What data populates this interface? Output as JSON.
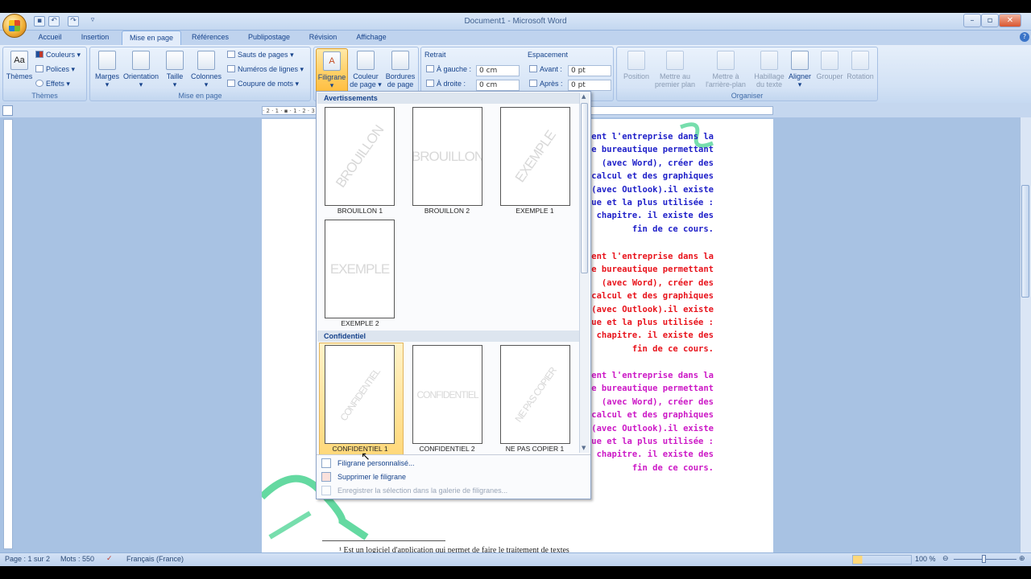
{
  "window": {
    "title": "Document1 - Microsoft Word"
  },
  "qat": {
    "save": "▪",
    "undo": "↶",
    "redo": "↷",
    "more": "▿"
  },
  "tabs": [
    "Accueil",
    "Insertion",
    "Mise en page",
    "Références",
    "Publipostage",
    "Révision",
    "Affichage"
  ],
  "ribbon": {
    "themes": {
      "label": "Thèmes",
      "group": "Thèmes",
      "couleurs": "Couleurs",
      "polices": "Polices",
      "effets": "Effets"
    },
    "mise_en_page": {
      "group": "Mise en page",
      "marges": "Marges",
      "orientation": "Orientation",
      "taille": "Taille",
      "colonnes": "Colonnes",
      "sauts": "Sauts de pages",
      "numeros": "Numéros de lignes",
      "coupure": "Coupure de mots"
    },
    "arriere_plan": {
      "filigrane": "Filigrane",
      "couleur1": "Couleur",
      "couleur2": "de page",
      "bordures1": "Bordures",
      "bordures2": "de page"
    },
    "paragraphe": {
      "retrait": "Retrait",
      "gauche_label": "À gauche :",
      "gauche_value": "0 cm",
      "droite_label": "À droite :",
      "droite_value": "0 cm",
      "espacement": "Espacement",
      "avant_label": "Avant :",
      "avant_value": "0 pt",
      "apres_label": "Après :",
      "apres_value": "0 pt"
    },
    "organiser": {
      "group": "Organiser",
      "position": "Position",
      "premier1": "Mettre au",
      "premier2": "premier plan",
      "arriere1": "Mettre à",
      "arriere2": "l'arrière-plan",
      "habillage1": "Habillage",
      "habillage2": "du texte",
      "aligner": "Aligner",
      "grouper": "Grouper",
      "rotation": "Rotation"
    }
  },
  "ruler": {
    "marks": "· 2 · 1 · ▪ · 1 · 2 · 3 · 4 · 5 · 6 · 7 · 8 · 9 · 10 · 11 · 12 · 13 · 14 · 15 · ▲16 · 17 · 18"
  },
  "gallery": {
    "section1": "Avertissements",
    "section2": "Confidentiel",
    "items1": [
      {
        "wm": "BROUILLON",
        "label": "BROUILLON 1"
      },
      {
        "wm": "BROUILLON",
        "label": "BROUILLON 2"
      },
      {
        "wm": "EXEMPLE",
        "label": "EXEMPLE 1"
      },
      {
        "wm": "EXEMPLE",
        "label": "EXEMPLE 2"
      }
    ],
    "items2": [
      {
        "wm": "CONFIDENTIEL",
        "label": "CONFIDENTIEL 1"
      },
      {
        "wm": "CONFIDENTIEL",
        "label": "CONFIDENTIEL 2"
      },
      {
        "wm": "NE PAS COPIER",
        "label": "NE PAS COPIER 1"
      }
    ],
    "menu": [
      "Filigrane personnalisé...",
      "Supprimer le filigrane",
      "Enregistrer la sélection dans la galerie de filigranes..."
    ]
  },
  "document": {
    "paragraph_lines": [
      "aident l'entreprise dans la",
      "e bureautique permettant",
      "(avec Word), créer des",
      "calcul et des graphiques",
      "ls (avec Outlook).il existe",
      "onnue et la plus utilisée :",
      "e chapitre. il existe des",
      "fin de ce cours."
    ],
    "colors": {
      "p1": "#1d1ec8",
      "p2": "#e8121b",
      "p3": "#cc18c6"
    },
    "footnote": "¹ Est un logiciel  d'application qui permet de faire le traitement de textes"
  },
  "status": {
    "page": "Page : 1 sur 2",
    "mots": "Mots : 550",
    "langue": "Français (France)",
    "zoom": "100 %"
  }
}
